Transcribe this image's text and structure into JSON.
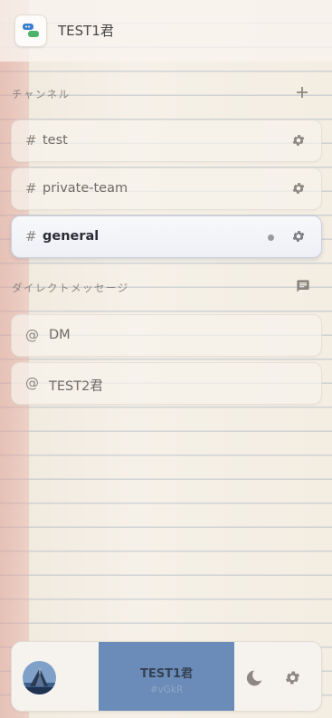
{
  "header": {
    "title": "TEST1君",
    "app_icon": "chat-bubbles-icon"
  },
  "channels": {
    "section_title": "チャンネル",
    "add_icon": "plus-icon",
    "items": [
      {
        "prefix": "#",
        "label": "test",
        "active": false,
        "unread": false
      },
      {
        "prefix": "#",
        "label": "private-team",
        "active": false,
        "unread": false
      },
      {
        "prefix": "#",
        "label": "general",
        "active": true,
        "unread": true
      }
    ]
  },
  "direct_messages": {
    "section_title": "ダイレクトメッセージ",
    "action_icon": "message-icon",
    "items": [
      {
        "prefix": "@",
        "label": "DM"
      },
      {
        "prefix": "@",
        "label": "TEST2君"
      }
    ]
  },
  "footer": {
    "user_name": "TEST1君",
    "user_id": "#vGkR",
    "theme_icon": "moon-icon",
    "settings_icon": "gear-icon"
  },
  "colors": {
    "accent_user_block": "#6b8cb8",
    "active_item_bg": "#eef0f6",
    "margin_line": "#e0a096"
  }
}
